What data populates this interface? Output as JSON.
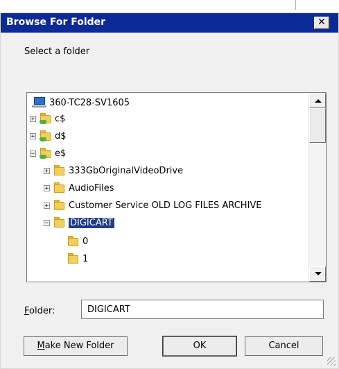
{
  "dialog": {
    "title": "Browse For Folder",
    "close_glyph": "✕",
    "prompt": "Select a folder"
  },
  "tree": {
    "items": [
      {
        "label": "360-TC28-SV1605",
        "icon": "computer-icon",
        "toggle": ""
      },
      {
        "label": "c$",
        "icon": "shared-drive-icon",
        "toggle": "+"
      },
      {
        "label": "d$",
        "icon": "shared-drive-icon",
        "toggle": "+"
      },
      {
        "label": "e$",
        "icon": "shared-drive-icon",
        "toggle": "−"
      },
      {
        "label": "333GbOriginalVideoDrive",
        "icon": "folder-icon",
        "toggle": "+"
      },
      {
        "label": "AudioFiles",
        "icon": "folder-icon",
        "toggle": "+"
      },
      {
        "label": "Customer Service OLD LOG FILES ARCHIVE",
        "icon": "folder-icon",
        "toggle": "+"
      },
      {
        "label": "DIGICART",
        "icon": "folder-icon",
        "toggle": "−",
        "selected": true
      },
      {
        "label": "0",
        "icon": "folder-icon",
        "toggle": ""
      },
      {
        "label": "1",
        "icon": "folder-icon",
        "toggle": ""
      }
    ]
  },
  "folder_field": {
    "label_accel": "F",
    "label_rest": "older:",
    "value": "DIGICART"
  },
  "buttons": {
    "make_new_accel": "M",
    "make_new_rest": "ake New Folder",
    "ok": "OK",
    "cancel": "Cancel"
  },
  "colors": {
    "titlebar": "#0b2a98",
    "selection": "#1f3d87"
  }
}
